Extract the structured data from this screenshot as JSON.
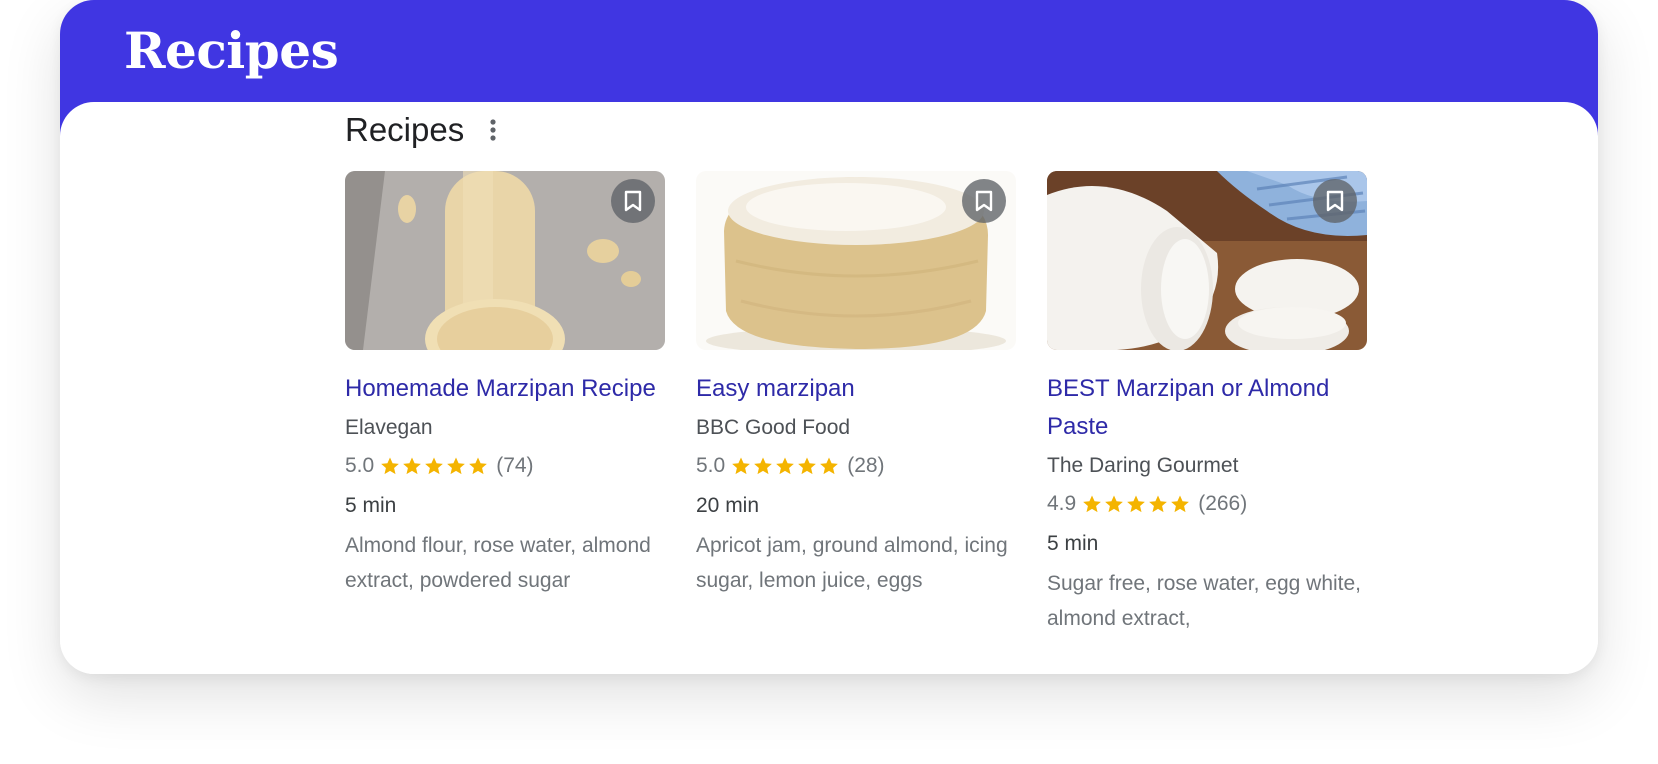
{
  "banner": {
    "title": "Recipes"
  },
  "section": {
    "title": "Recipes",
    "menu_icon": "more-vertical-icon"
  },
  "recipes": [
    {
      "title": "Homemade Marzipan Recipe",
      "source": "Elavegan",
      "rating": "5.0",
      "stars": 5,
      "reviews": "(74)",
      "time": "5 min",
      "ingredients": "Almond flour, rose water, almond extract, powdered sugar",
      "save_icon": "bookmark-icon"
    },
    {
      "title": "Easy marzipan",
      "source": "BBC Good Food",
      "rating": "5.0",
      "stars": 5,
      "reviews": "(28)",
      "time": "20 min",
      "ingredients": "Apricot jam, ground almond, icing sugar, lemon juice, eggs",
      "save_icon": "bookmark-icon"
    },
    {
      "title": "BEST Marzipan or Almond Paste",
      "source": "The Daring Gourmet",
      "rating": "4.9",
      "stars": 5,
      "reviews": "(266)",
      "time": "5 min",
      "ingredients": "Sugar free, rose water, egg white, almond extract,",
      "save_icon": "bookmark-icon"
    }
  ],
  "colors": {
    "banner": "#4036e2",
    "link": "#2e2aa8",
    "star": "#f4b400"
  }
}
